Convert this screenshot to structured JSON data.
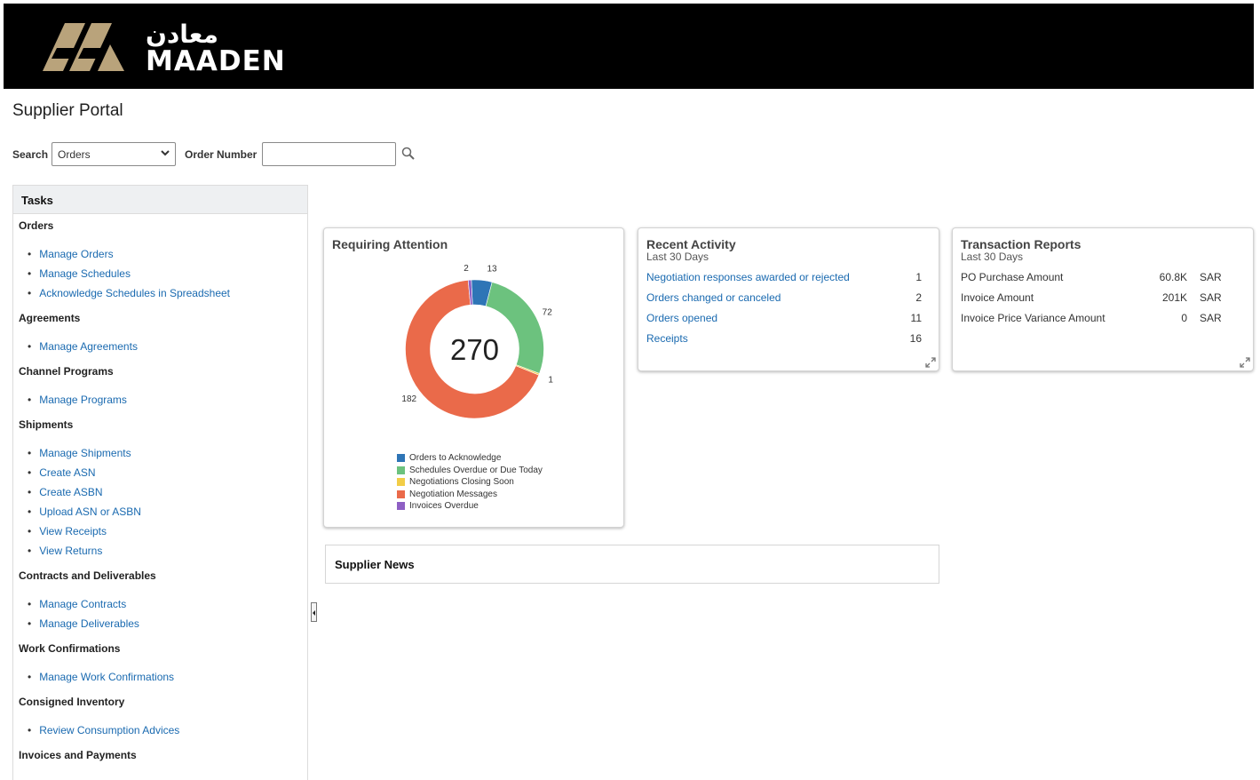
{
  "brand": {
    "name_ar": "معادن",
    "name_en": "MAADEN",
    "logo_color": "#b9a37b"
  },
  "page_title": "Supplier Portal",
  "search": {
    "label": "Search",
    "selected": "Orders",
    "field_label": "Order Number",
    "value": "",
    "icon": "search-icon"
  },
  "tasks": {
    "title": "Tasks",
    "sections": [
      {
        "title": "Orders",
        "links": [
          "Manage Orders",
          "Manage Schedules",
          "Acknowledge Schedules in Spreadsheet"
        ]
      },
      {
        "title": "Agreements",
        "links": [
          "Manage Agreements"
        ]
      },
      {
        "title": "Channel Programs",
        "links": [
          "Manage Programs"
        ]
      },
      {
        "title": "Shipments",
        "links": [
          "Manage Shipments",
          "Create ASN",
          "Create ASBN",
          "Upload ASN or ASBN",
          "View Receipts",
          "View Returns"
        ]
      },
      {
        "title": "Contracts and Deliverables",
        "links": [
          "Manage Contracts",
          "Manage Deliverables"
        ]
      },
      {
        "title": "Work Confirmations",
        "links": [
          "Manage Work Confirmations"
        ]
      },
      {
        "title": "Consigned Inventory",
        "links": [
          "Review Consumption Advices"
        ]
      },
      {
        "title": "Invoices and Payments",
        "links": []
      }
    ]
  },
  "requiring_attention": {
    "title": "Requiring Attention",
    "total": "270"
  },
  "chart_data": {
    "type": "pie",
    "title": "Requiring Attention",
    "center_total": 270,
    "series": [
      {
        "name": "Orders to Acknowledge",
        "value": 13,
        "color": "#2e75b6"
      },
      {
        "name": "Schedules Overdue or Due Today",
        "value": 72,
        "color": "#6cc27e"
      },
      {
        "name": "Negotiations Closing Soon",
        "value": 1,
        "color": "#f2cd47"
      },
      {
        "name": "Negotiation Messages",
        "value": 182,
        "color": "#ea6a4a"
      },
      {
        "name": "Invoices Overdue",
        "value": 2,
        "color": "#8e5fc4"
      }
    ],
    "legend_position": "bottom"
  },
  "recent_activity": {
    "title": "Recent Activity",
    "subtitle": "Last 30 Days",
    "rows": [
      {
        "label": "Negotiation responses awarded or rejected",
        "value": "1"
      },
      {
        "label": "Orders changed or canceled",
        "value": "2"
      },
      {
        "label": "Orders opened",
        "value": "11"
      },
      {
        "label": "Receipts",
        "value": "16"
      }
    ]
  },
  "transaction_reports": {
    "title": "Transaction Reports",
    "subtitle": "Last 30 Days",
    "rows": [
      {
        "label": "PO Purchase Amount",
        "amount": "60.8K",
        "currency": "SAR"
      },
      {
        "label": "Invoice Amount",
        "amount": "201K",
        "currency": "SAR"
      },
      {
        "label": "Invoice Price Variance Amount",
        "amount": "0",
        "currency": "SAR"
      }
    ]
  },
  "supplier_news": {
    "title": "Supplier News"
  }
}
